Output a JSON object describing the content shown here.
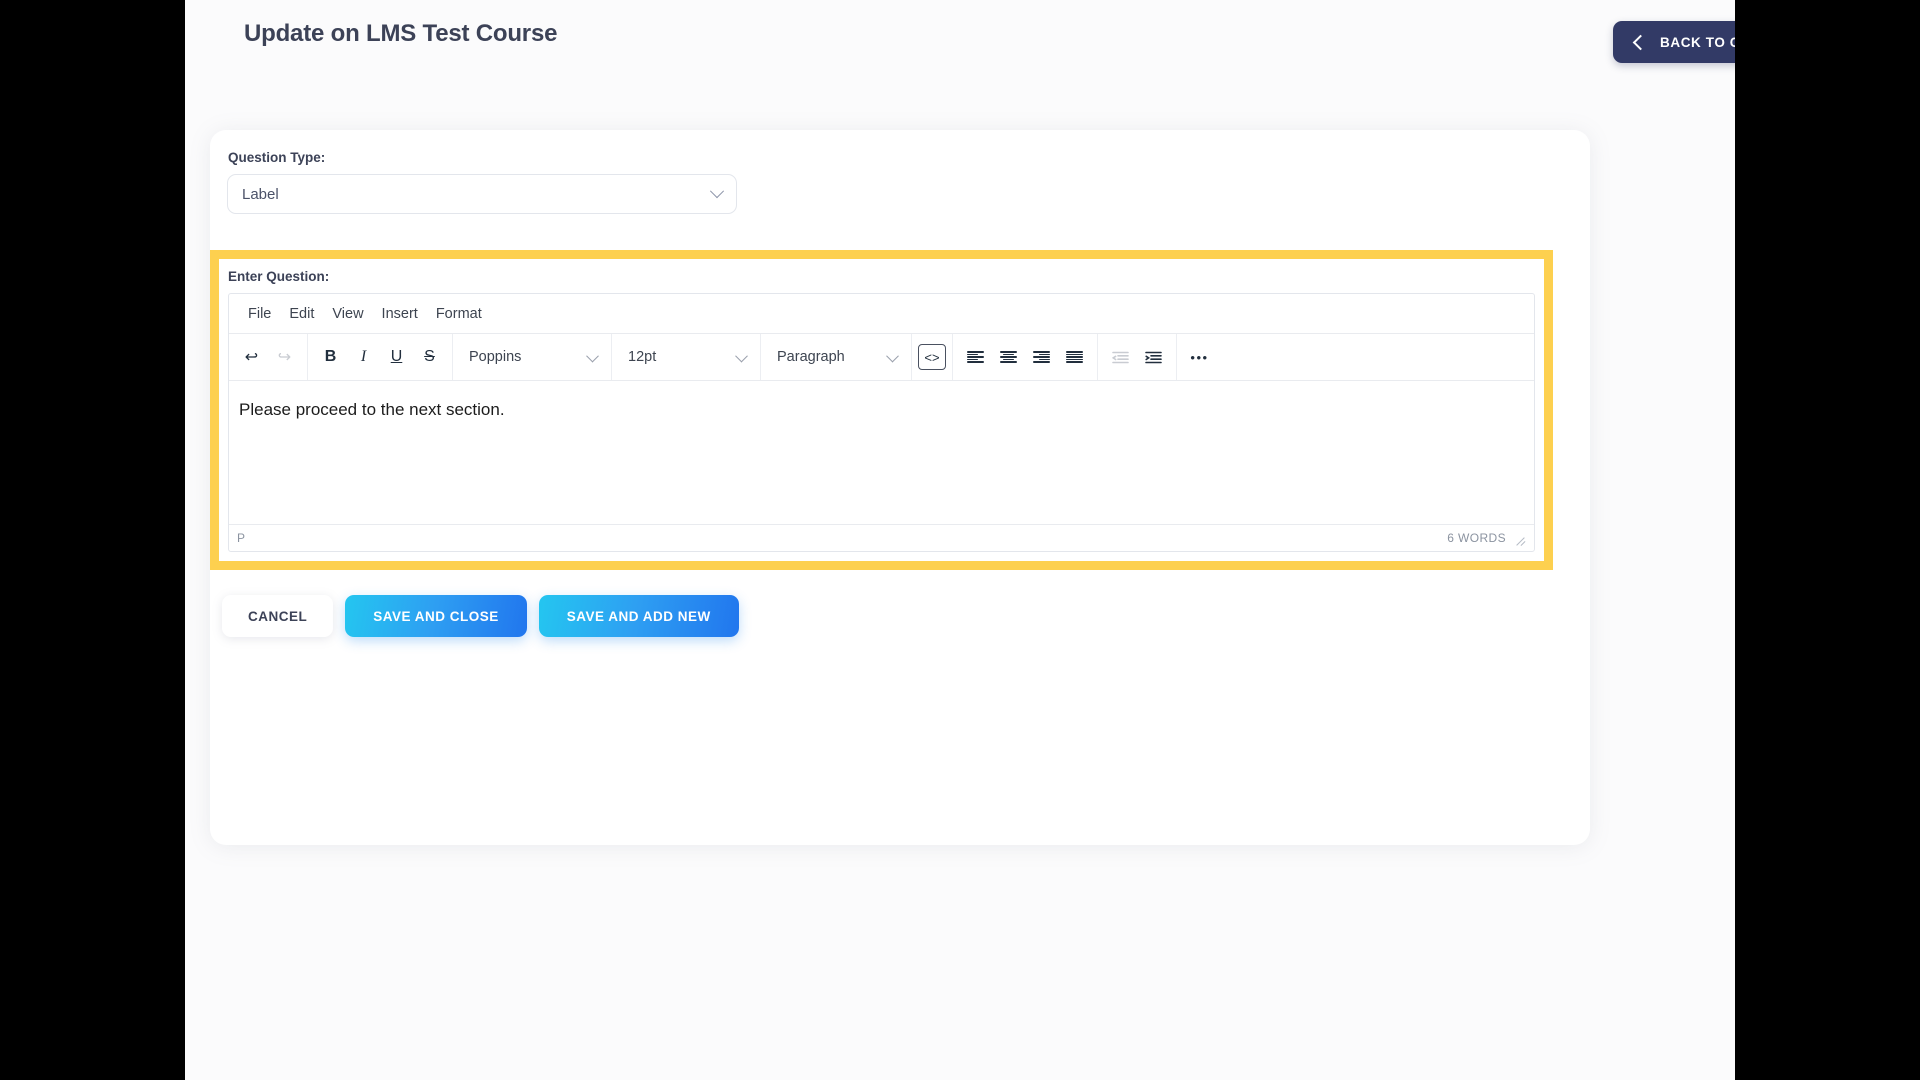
{
  "header": {
    "title": "Update on LMS Test Course",
    "back_button": {
      "label": "BACK TO C",
      "icon": "chevron-left-icon",
      "color": "#323a66"
    }
  },
  "form": {
    "question_type": {
      "label": "Question Type:",
      "value": "Label",
      "icon": "chevron-down-icon"
    },
    "enter_question": {
      "label": "Enter Question:",
      "highlight_color": "#fdd04f"
    }
  },
  "editor": {
    "menubar": [
      "File",
      "Edit",
      "View",
      "Insert",
      "Format"
    ],
    "toolbar": {
      "undo": {
        "name": "undo-icon",
        "glyph": "↩",
        "disabled": false
      },
      "redo": {
        "name": "redo-icon",
        "glyph": "↪",
        "disabled": true
      },
      "bold": {
        "name": "bold-icon",
        "glyph": "B"
      },
      "italic": {
        "name": "italic-icon",
        "glyph": "I"
      },
      "underline": {
        "name": "underline-icon",
        "glyph": "U"
      },
      "strikethrough": {
        "name": "strikethrough-icon",
        "glyph": "S"
      },
      "font_family": "Poppins",
      "font_size": "12pt",
      "block_format": "Paragraph",
      "source_code": {
        "name": "source-code-icon",
        "glyph": "<>"
      },
      "align_left": "align-left-icon",
      "align_center": "align-center-icon",
      "align_right": "align-right-icon",
      "align_justify": "align-justify-icon",
      "outdent": {
        "name": "outdent-icon",
        "disabled": true
      },
      "indent": {
        "name": "indent-icon",
        "disabled": false
      },
      "more": {
        "name": "more-options-icon",
        "glyph": "•••"
      }
    },
    "content": "Please proceed to the next section.",
    "statusbar": {
      "element_path": "P",
      "word_count": "6 WORDS",
      "resize_handle": "resize-grip-icon"
    }
  },
  "actions": {
    "cancel": "CANCEL",
    "save_and_close": "SAVE AND CLOSE",
    "save_and_add_new": "SAVE AND ADD NEW"
  }
}
